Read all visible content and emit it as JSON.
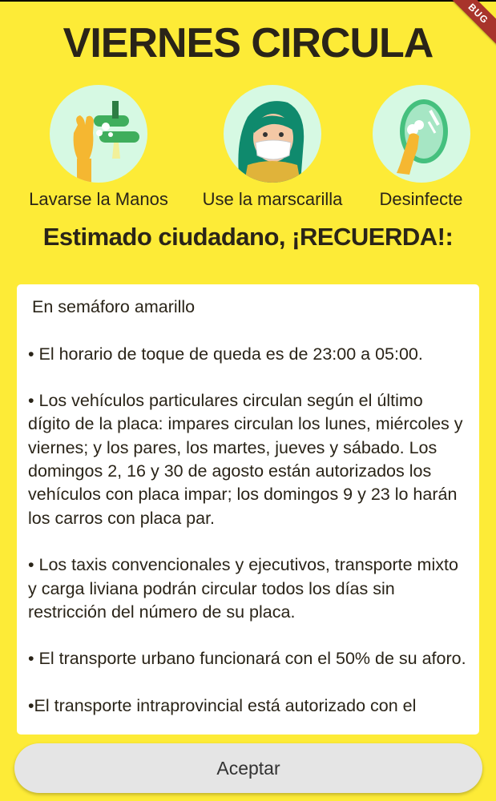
{
  "debug_banner": "BUG",
  "title": "VIERNES CIRCULA",
  "tips": [
    {
      "label": "Lavarse la Manos",
      "icon": "hand-washing-icon"
    },
    {
      "label": "Use la marscarilla",
      "icon": "face-mask-icon"
    },
    {
      "label": "Desinfecte",
      "icon": "disinfect-icon"
    }
  ],
  "subtitle": "Estimado ciudadano, ¡RECUERDA!:",
  "card": {
    "paragraphs": [
      "En semáforo amarillo",
      "• El horario de toque de queda es de 23:00 a 05:00.",
      "• Los vehículos particulares circulan según el último dígito de la placa: impares circulan los lunes, miércoles y viernes; y los pares, los martes, jueves y sábado. Los domingos 2, 16 y 30 de agosto están autorizados los vehículos con placa impar; los domingos 9 y 23 lo harán los carros con placa par.",
      "• Los taxis convencionales y ejecutivos, transporte mixto y carga liviana podrán circular todos los días sin restricción del número de su placa.",
      "• El transporte urbano funcionará con el 50% de su aforo.",
      "•El transporte intraprovincial está autorizado con el"
    ]
  },
  "accept_label": "Aceptar",
  "colors": {
    "background": "#fdeb37",
    "card": "#ffffff",
    "icon_circle": "#d6f9e3",
    "button": "#e5e5e5"
  }
}
